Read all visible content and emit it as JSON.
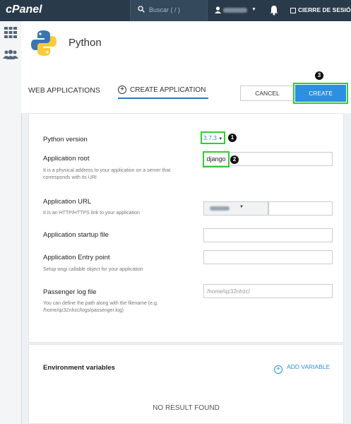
{
  "topbar": {
    "logo": "cPanel",
    "search_placeholder": "Buscar ( / )",
    "logout_label": "CIERRE DE SESIÓN",
    "bg_color": "#293a4a"
  },
  "page": {
    "title": "Python",
    "icon": "python-logo"
  },
  "tabs": {
    "web_applications": "WEB APPLICATIONS",
    "create_application": "CREATE APPLICATION"
  },
  "actions": {
    "cancel": "CANCEL",
    "create": "CREATE"
  },
  "form": {
    "python_version": {
      "label": "Python version",
      "value": "3.7.3"
    },
    "application_root": {
      "label": "Application root",
      "value": "django",
      "help": "It is a physical address to your application on a server that corresponds with its URI"
    },
    "application_url": {
      "label": "Application URL",
      "help": "It is an HTTP/HTTPS link to your application"
    },
    "startup_file": {
      "label": "Application startup file"
    },
    "entry_point": {
      "label": "Application Entry point",
      "help": "Setup wsgi callable object for your application"
    },
    "passenger_log": {
      "label": "Passenger log file",
      "placeholder": "/home/qz32nhzc/",
      "help": "You can define the path along with the filename (e.g. /home/qz32nhzc/logs/passenger.log)"
    }
  },
  "env": {
    "title": "Environment variables",
    "add_label": "ADD VARIABLE",
    "empty": "NO RESULT FOUND"
  },
  "annotations": {
    "one": "1",
    "two": "2",
    "three": "3"
  },
  "colors": {
    "accent": "#2d8fe0",
    "highlight": "#32cd32"
  }
}
